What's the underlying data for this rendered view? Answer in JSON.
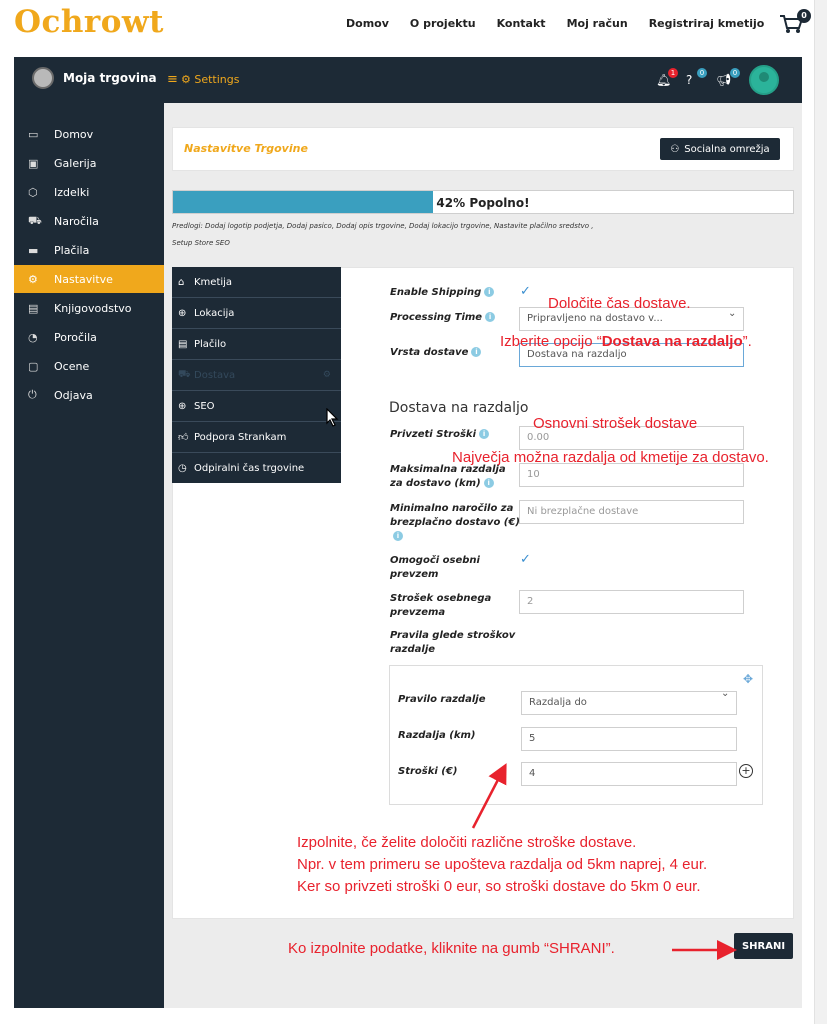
{
  "site": {
    "logo": "Ochrowt",
    "nav": [
      "Domov",
      "O projektu",
      "Kontakt",
      "Moj račun",
      "Registriraj kmetijo"
    ],
    "cart_count": "0"
  },
  "appbar": {
    "store_name": "Moja trgovina",
    "breadcrumb": "Settings",
    "notif_count": "1",
    "help_count": "0",
    "announce_count": "0"
  },
  "sidebar": {
    "items": [
      {
        "label": "Domov",
        "icon": "monitor-icon"
      },
      {
        "label": "Galerija",
        "icon": "image-icon"
      },
      {
        "label": "Izdelki",
        "icon": "box-icon"
      },
      {
        "label": "Naročila",
        "icon": "cart-icon"
      },
      {
        "label": "Plačila",
        "icon": "card-icon"
      },
      {
        "label": "Nastavitve",
        "icon": "gears-icon",
        "active": true
      },
      {
        "label": "Knjigovodstvo",
        "icon": "money-icon"
      },
      {
        "label": "Poročila",
        "icon": "chart-icon"
      },
      {
        "label": "Ocene",
        "icon": "comment-icon"
      },
      {
        "label": "Odjava",
        "icon": "power-icon"
      }
    ]
  },
  "page": {
    "title": "Nastavitve Trgovine",
    "social_button": "Socialna omrežja",
    "progress_percent": 42,
    "progress_label": "42% Popolno!",
    "suggestion_line1": "Predlogi: Dodaj logotip podjetja, Dodaj pasico, Dodaj opis trgovine, Dodaj lokacijo trgovine, Nastavite plačilno sredstvo ,",
    "suggestion_line2": "Setup Store SEO"
  },
  "submenu": [
    {
      "label": "Kmetija",
      "icon": "store-icon"
    },
    {
      "label": "Lokacija",
      "icon": "globe-icon"
    },
    {
      "label": "Plačilo",
      "icon": "money-icon"
    },
    {
      "label": "Dostava",
      "icon": "truck-icon",
      "disabled": true
    },
    {
      "label": "SEO",
      "icon": "globe-icon"
    },
    {
      "label": "Podpora Strankam",
      "icon": "thumbs-up-icon"
    },
    {
      "label": "Odpiralni čas trgovine",
      "icon": "clock-icon"
    }
  ],
  "form": {
    "enable_shipping_label": "Enable Shipping",
    "enable_shipping_checked": true,
    "processing_time_label": "Processing Time",
    "processing_time_value": "Pripravljeno na dostavo v...",
    "shipping_type_label": "Vrsta dostave",
    "shipping_type_value": "Dostava na razdaljo",
    "section_title": "Dostava na razdaljo",
    "default_cost_label": "Privzeti Stroški",
    "default_cost_value": "0.00",
    "max_distance_label_1": "Maksimalna razdalja",
    "max_distance_label_2": "za dostavo (km)",
    "max_distance_value": "10",
    "min_order_label_1": "Minimalno naročilo za",
    "min_order_label_2": "brezplačno dostavo (€)",
    "min_order_placeholder": "Ni brezplačne dostave",
    "pickup_label_1": "Omogoči osebni",
    "pickup_label_2": "prevzem",
    "pickup_checked": true,
    "pickup_cost_label_1": "Strošek osebnega",
    "pickup_cost_label_2": "prevzema",
    "pickup_cost_value": "2",
    "rules_label_1": "Pravila glede stroškov",
    "rules_label_2": "razdalje",
    "rule": {
      "rule_label": "Pravilo razdalje",
      "rule_value": "Razdalja do",
      "distance_label": "Razdalja (km)",
      "distance_value": "5",
      "cost_label": "Stroški (€)",
      "cost_value": "4"
    },
    "save_button": "SHRANI"
  },
  "annotations": {
    "a1": "Določite čas dostave.",
    "a2_pre": "Izberite opcijo “",
    "a2_bold": "Dostava na razdaljo",
    "a2_post": "”.",
    "a3": "Osnovni strošek dostave",
    "a4": "Največja možna razdalja od kmetije za dostavo.",
    "a5_line1": "Izpolnite, če želite določiti različne stroške dostave.",
    "a5_line2": "Npr. v tem primeru se upošteva razdalja od 5km naprej, 4 eur.",
    "a5_line3": "Ker so privzeti stroški 0 eur, so stroški dostave do 5km 0 eur.",
    "a6": "Ko izpolnite podatke, kliknite na gumb “SHRANI”."
  },
  "colors": {
    "accent": "#f0a81c",
    "dark": "#1d2a36",
    "progress": "#3a9fbf",
    "annotation": "#e8222d"
  }
}
